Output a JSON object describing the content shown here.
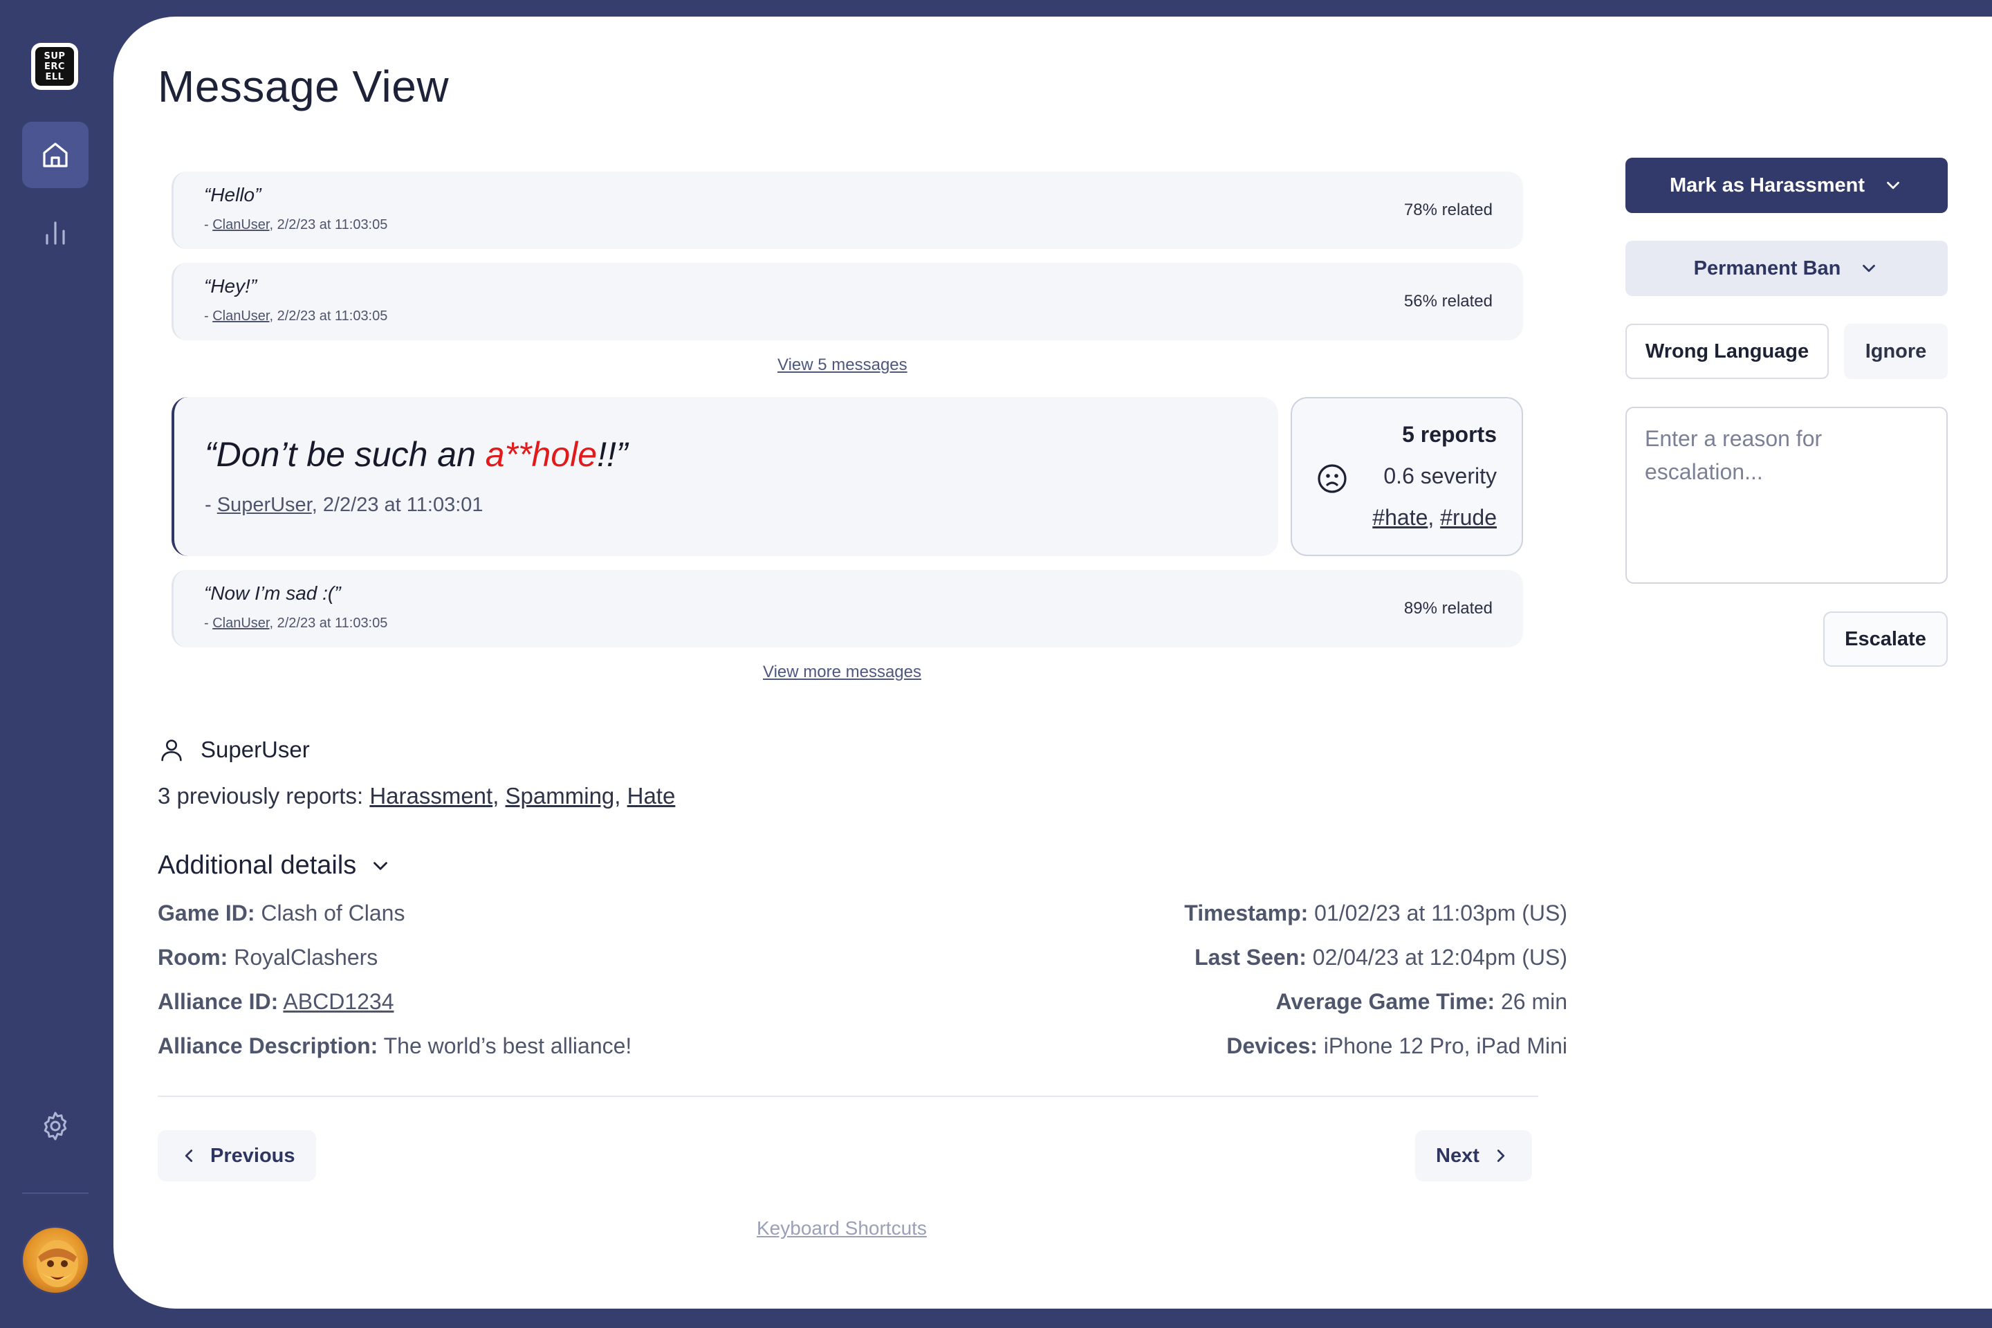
{
  "sidebar": {
    "logo_text": [
      "SUP",
      "ERC",
      "ELL"
    ],
    "nav": [
      {
        "name": "home",
        "icon": "home-icon"
      },
      {
        "name": "analytics",
        "icon": "bar-chart-icon"
      },
      {
        "name": "settings",
        "icon": "gear-icon"
      }
    ],
    "avatar_icon": "barbarian-avatar"
  },
  "page": {
    "title": "Message View"
  },
  "messages_before": [
    {
      "text": "“Hello”",
      "prefix": "- ",
      "user": "ClanUser",
      "time": ", 2/2/23 at 11:03:05",
      "related": "78% related"
    },
    {
      "text": "“Hey!”",
      "prefix": "- ",
      "user": "ClanUser",
      "time": ", 2/2/23 at 11:03:05",
      "related": "56% related"
    }
  ],
  "view_5_messages": "View 5 messages",
  "flagged_message": {
    "text_before": "“Don’t be such an ",
    "text_flagged": "a**hole",
    "text_after": "!!”",
    "prefix": "- ",
    "user": "SuperUser",
    "time": ", 2/2/23 at 11:03:01"
  },
  "report": {
    "count": "5 reports",
    "severity": "0.6 severity",
    "tags": [
      "#hate",
      "#rude"
    ],
    "tag_separator": ", "
  },
  "messages_after": [
    {
      "text": "“Now I’m sad :(”",
      "prefix": "- ",
      "user": "ClanUser",
      "time": ", 2/2/23 at 11:03:05",
      "related": "89% related"
    }
  ],
  "view_more_messages": "View more messages",
  "user": {
    "name": "SuperUser",
    "prev_reports_label": "3 previously reports: ",
    "prev_reports": [
      "Harassment",
      "Spamming",
      "Hate"
    ]
  },
  "details": {
    "title": "Additional details",
    "left": [
      {
        "label": "Game ID:",
        "value": " Clash of Clans",
        "link": false
      },
      {
        "label": "Room:",
        "value": " RoyalClashers",
        "link": false
      },
      {
        "label": "Alliance ID:",
        "value": "ABCD1234",
        "link": true
      },
      {
        "label": "Alliance Description:",
        "value": " The world’s best alliance!",
        "link": false
      }
    ],
    "right": [
      {
        "label": "Timestamp:",
        "value": " 01/02/23 at 11:03pm (US)"
      },
      {
        "label": "Last Seen:",
        "value": " 02/04/23 at 12:04pm (US)"
      },
      {
        "label": "Average Game Time:",
        "value": " 26 min"
      },
      {
        "label": "Devices:",
        "value": " iPhone 12 Pro, iPad Mini"
      }
    ]
  },
  "pager": {
    "previous": "Previous",
    "next": "Next"
  },
  "keyboard_shortcuts": "Keyboard Shortcuts",
  "actions": {
    "mark_as": "Mark as Harassment",
    "ban": "Permanent Ban",
    "wrong_language": "Wrong Language",
    "ignore": "Ignore",
    "reason_placeholder": "Enter a reason for escalation...",
    "escalate": "Escalate"
  },
  "colors": {
    "frame": "#363e6e",
    "primary": "#313a6b",
    "flagged_word": "#e21a1a"
  }
}
